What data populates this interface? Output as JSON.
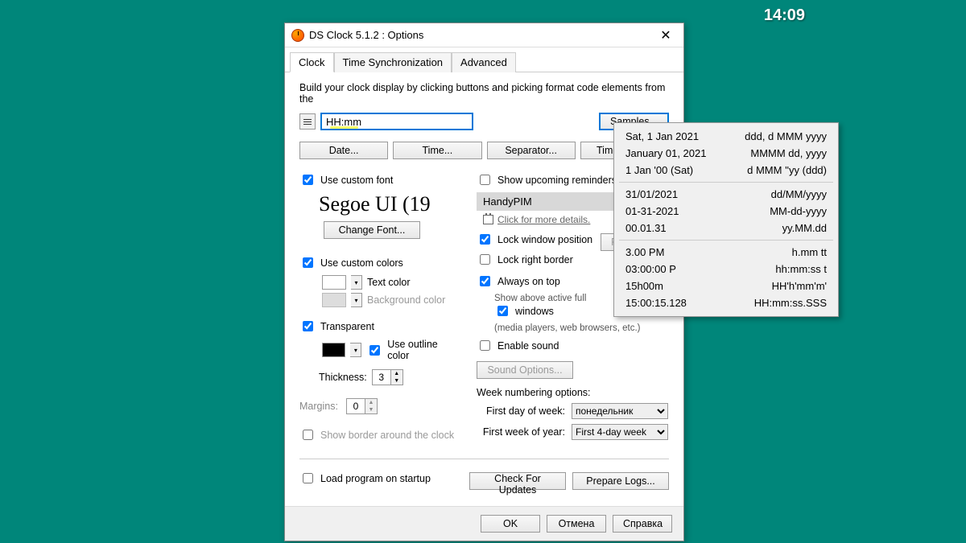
{
  "desktop_clock": "14:09",
  "window": {
    "title": "DS Clock 5.1.2 : Options"
  },
  "tabs": [
    "Clock",
    "Time Synchronization",
    "Advanced"
  ],
  "active_tab": 0,
  "instruction": "Build your clock display by clicking buttons and picking format code elements from the",
  "format_value": "HH:mm",
  "samples_btn": "Samples...",
  "format_buttons": [
    "Date...",
    "Time...",
    "Separator...",
    "Time Zone..."
  ],
  "left": {
    "use_custom_font": "Use custom font",
    "font_preview": "Segoe UI (19",
    "change_font": "Change Font...",
    "use_custom_colors": "Use custom colors",
    "text_color": "Text color",
    "bg_color": "Background color",
    "transparent": "Transparent",
    "use_outline": "Use outline color",
    "thickness_label": "Thickness:",
    "thickness_value": "3",
    "margins_label": "Margins:",
    "margins_value": "0",
    "show_border": "Show border around the clock"
  },
  "right": {
    "show_reminders": "Show upcoming reminders f",
    "handypim": "HandyPIM",
    "click_details": "Click for more details.",
    "lock_window": "Lock window position",
    "find_btn": "Find",
    "lock_right": "Lock right border",
    "always_on_top": "Always on top",
    "show_above": "Show above active full",
    "show_above2": "windows",
    "show_above_note": "(media players, web browsers, etc.)",
    "enable_sound": "Enable sound",
    "sound_options": "Sound Options...",
    "week_numbering": "Week numbering options:",
    "first_day_label": "First day of week:",
    "first_day_value": "понедельник",
    "first_week_label": "First week of year:",
    "first_week_value": "First 4-day week"
  },
  "bottom": {
    "load_startup": "Load program on startup",
    "check_updates": "Check For Updates",
    "prepare_logs": "Prepare Logs..."
  },
  "dialog_buttons": {
    "ok": "OK",
    "cancel": "Отмена",
    "help": "Справка"
  },
  "samples_menu": [
    [
      {
        "preview": "Sat, 1 Jan 2021",
        "fmt": "ddd, d MMM yyyy"
      },
      {
        "preview": "January 01, 2021",
        "fmt": "MMMM dd, yyyy"
      },
      {
        "preview": "1 Jan '00 (Sat)",
        "fmt": "d MMM ''yy (ddd)"
      }
    ],
    [
      {
        "preview": "31/01/2021",
        "fmt": "dd/MM/yyyy"
      },
      {
        "preview": "01-31-2021",
        "fmt": "MM-dd-yyyy"
      },
      {
        "preview": "00.01.31",
        "fmt": "yy.MM.dd"
      }
    ],
    [
      {
        "preview": "3.00 PM",
        "fmt": "h.mm tt"
      },
      {
        "preview": "03:00:00 P",
        "fmt": "hh:mm:ss t"
      },
      {
        "preview": "15h00m",
        "fmt": "HH'h'mm'm'"
      },
      {
        "preview": "15:00:15.128",
        "fmt": "HH:mm:ss.SSS"
      }
    ]
  ]
}
